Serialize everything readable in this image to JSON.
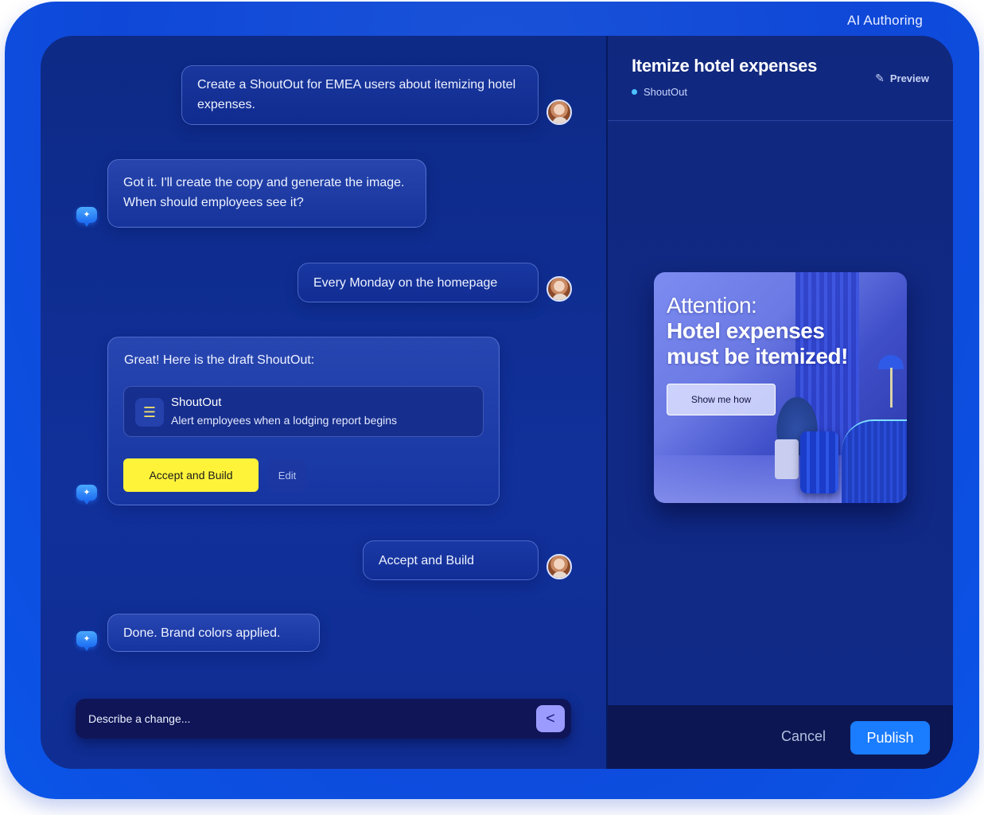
{
  "window": {
    "title": "AI Authoring"
  },
  "chat": {
    "messages": [
      {
        "from": "user",
        "text": "Create a ShoutOut for EMEA users about itemizing hotel expenses."
      },
      {
        "from": "bot",
        "text": "Got it. I'll create the copy and generate the image. When should employees see it?"
      },
      {
        "from": "user",
        "text": "Every Monday on the homepage"
      },
      {
        "from": "bot",
        "text": "Great! Here is the draft ShoutOut:"
      },
      {
        "from": "user",
        "text": "Accept and Build"
      },
      {
        "from": "bot",
        "text": "Done. Brand colors applied."
      }
    ],
    "draft_card": {
      "icon": "list-icon",
      "title": "ShoutOut",
      "subtitle": "Alert employees when a lodging report begins",
      "accept_label": "Accept and Build",
      "edit_label": "Edit"
    },
    "input": {
      "placeholder": "Describe a change...",
      "value": "",
      "send_icon": "send-arrow-icon"
    }
  },
  "preview": {
    "title": "Itemize hotel expenses",
    "tag": "ShoutOut",
    "preview_label": "Preview",
    "promo": {
      "line1": "Attention:",
      "line2": "Hotel expenses",
      "line3": "must be itemized!",
      "button": "Show me how"
    },
    "footer": {
      "cancel": "Cancel",
      "publish": "Publish"
    }
  },
  "colors": {
    "accent": "#1a7cff",
    "accept_button": "#fff33a",
    "send_button": "#9b9bff",
    "tag_dot": "#4cc3ff"
  }
}
